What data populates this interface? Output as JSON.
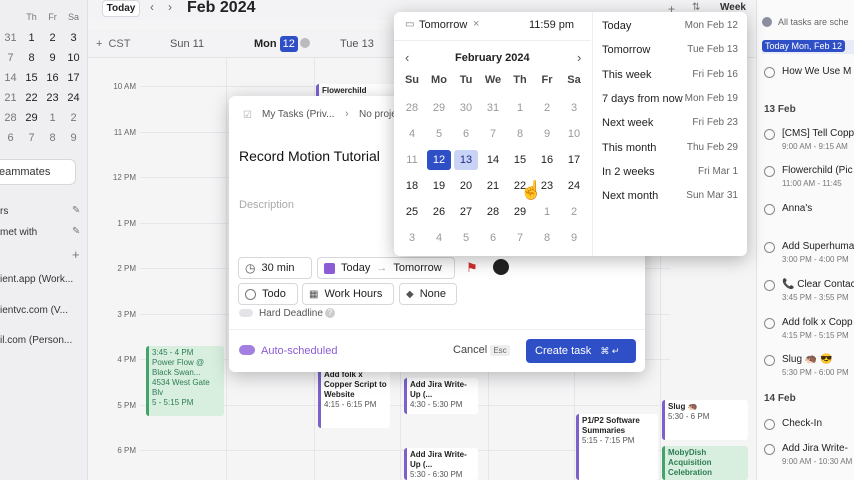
{
  "topbar": {
    "today_label": "Today",
    "month_title": "Feb 2024",
    "view_label": "Week"
  },
  "mini_calendar": {
    "dow": [
      "Th",
      "Fr",
      "Sa"
    ],
    "rows": [
      [
        "1",
        "2",
        "3"
      ],
      [
        "8",
        "9",
        "10"
      ],
      [
        "15",
        "16",
        "17"
      ],
      [
        "22",
        "23",
        "24"
      ],
      [
        "29",
        "1",
        "2"
      ],
      [
        "7",
        "8",
        "9"
      ]
    ],
    "partial_rows": [
      [
        "31"
      ],
      [
        "7"
      ],
      [
        "14"
      ],
      [
        "21"
      ],
      [
        "28"
      ],
      [
        "6"
      ]
    ]
  },
  "sidebar": {
    "teammates": "eammates",
    "items": [
      "rs",
      "met with",
      "ient.app (Work...",
      "ientvc.com (V...",
      "il.com (Person..."
    ]
  },
  "dayheader": {
    "tz": "CST",
    "days": [
      {
        "dow": "Sun",
        "num": "11"
      },
      {
        "dow": "Mon",
        "num": "12"
      },
      {
        "dow": "Tue",
        "num": "13"
      }
    ]
  },
  "times": [
    "10 AM",
    "11 AM",
    "12 PM",
    "1 PM",
    "2 PM",
    "3 PM",
    "4 PM",
    "5 PM",
    "6 PM"
  ],
  "events": [
    {
      "title": "Flowerchild",
      "sub": ""
    },
    {
      "title": "Power Flow @ Black Swan...",
      "sub": "4534 West Gate Blv",
      "time": "3:45 - 4 PM",
      "time2": "5 - 5:15 PM"
    },
    {
      "title": "Add folk x Copper Script to Website",
      "sub": "4:15 - 6:15 PM",
      "frac": "1/2"
    },
    {
      "title": "Add Jira Write-Up (...",
      "sub": "4:30 - 5:30 PM",
      "frac": "3/4"
    },
    {
      "title": "Add Jira Write-Up (...",
      "sub": "5:30 - 6:30 PM",
      "frac": "4/4"
    },
    {
      "title": "P1/P2 Software Summaries",
      "sub": "5:15 - 7:15 PM"
    },
    {
      "title": "Slug 🦔",
      "sub": "5:30 - 6 PM"
    },
    {
      "title": "MobyDish Acquisition Celebration",
      "sub": ""
    }
  ],
  "rightpanel": {
    "note": "All tasks are sche",
    "today_header": "Today  Mon, Feb 12",
    "today_items": [
      "How We Use M"
    ],
    "d13": "13 Feb",
    "d13_items": [
      {
        "t": "[CMS] Tell Copp",
        "s": "9:00 AM - 9:15 AM"
      },
      {
        "t": "Flowerchild (Pic",
        "s": "11:00 AM - 11:45"
      },
      {
        "t": "Anna's",
        "s": ""
      },
      {
        "t": "Add Superhuma",
        "s": "3:00 PM - 4:00 PM"
      },
      {
        "t": "📞 Clear Contac",
        "s": "3:45 PM - 3:55 PM"
      },
      {
        "t": "Add folk x Copp",
        "s": "4:15 PM - 5:15 PM"
      },
      {
        "t": "Slug 🦔 😎",
        "s": "5:30 PM - 6:00 PM"
      }
    ],
    "d14": "14 Feb",
    "d14_items": [
      {
        "t": "Check-In",
        "s": ""
      },
      {
        "t": "Add Jira Write-",
        "s": "9:00 AM - 10:30 AM"
      }
    ]
  },
  "modal": {
    "breadcrumb_workspace": "My Tasks (Priv...",
    "breadcrumb_project": "No project",
    "title": "Record Motion Tutorial",
    "description_placeholder": "Description",
    "duration": "30 min",
    "date_start": "Today",
    "date_end": "Tomorrow",
    "status": "Todo",
    "hours": "Work Hours",
    "label": "None",
    "hard_deadline": "Hard Deadline",
    "auto_scheduled": "Auto-scheduled",
    "cancel": "Cancel",
    "cancel_key": "Esc",
    "create": "Create task",
    "create_key": "⌘ ↵"
  },
  "picker": {
    "date_value": "Tomorrow",
    "time_value": "11:59 pm",
    "month_title": "February 2024",
    "dow": [
      "Su",
      "Mo",
      "Tu",
      "We",
      "Th",
      "Fr",
      "Sa"
    ],
    "weeks": [
      [
        "28",
        "29",
        "30",
        "31",
        "1",
        "2",
        "3"
      ],
      [
        "4",
        "5",
        "6",
        "7",
        "8",
        "9",
        "10"
      ],
      [
        "11",
        "12",
        "13",
        "14",
        "15",
        "16",
        "17"
      ],
      [
        "18",
        "19",
        "20",
        "21",
        "22",
        "23",
        "24"
      ],
      [
        "25",
        "26",
        "27",
        "28",
        "29",
        "1",
        "2"
      ],
      [
        "3",
        "4",
        "5",
        "6",
        "7",
        "8",
        "9"
      ]
    ],
    "quick": [
      {
        "label": "Today",
        "date": "Mon Feb 12"
      },
      {
        "label": "Tomorrow",
        "date": "Tue Feb 13"
      },
      {
        "label": "This week",
        "date": "Fri Feb 16"
      },
      {
        "label": "7 days from now",
        "date": "Mon Feb 19"
      },
      {
        "label": "Next week",
        "date": "Fri Feb 23"
      },
      {
        "label": "This month",
        "date": "Thu Feb 29"
      },
      {
        "label": "In 2 weeks",
        "date": "Fri Mar 1"
      },
      {
        "label": "Next month",
        "date": "Sun Mar 31"
      }
    ]
  },
  "colors": {
    "accent": "#2f4fc7",
    "purple": "#7b61c9",
    "green": "#43a36a"
  }
}
